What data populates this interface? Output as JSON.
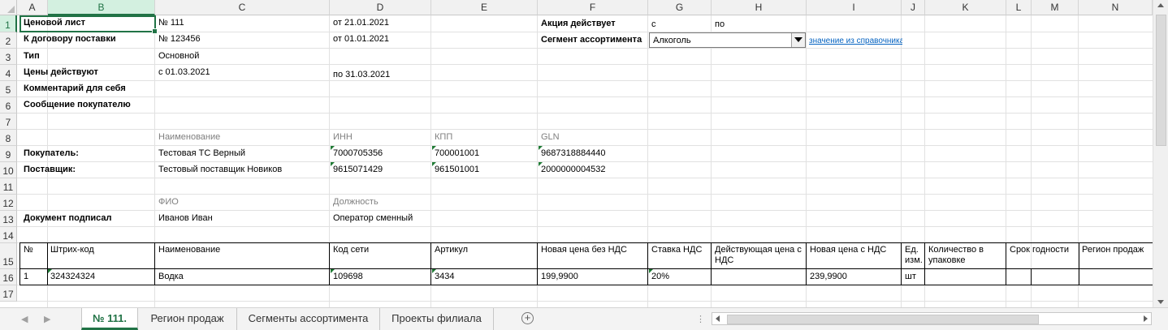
{
  "columns": [
    "A",
    "B",
    "C",
    "D",
    "E",
    "F",
    "G",
    "H",
    "I",
    "J",
    "K",
    "L",
    "M",
    "N"
  ],
  "rows": [
    "1",
    "2",
    "3",
    "4",
    "5",
    "6",
    "7",
    "8",
    "9",
    "10",
    "11",
    "12",
    "13",
    "14",
    "15",
    "16",
    "17"
  ],
  "header_block": {
    "price_list_label": "Ценовой лист",
    "price_list_no": "№ 111",
    "price_list_date": "от 21.01.2021",
    "contract_label": "К договору поставки",
    "contract_no": "№ 123456",
    "contract_date": "от 01.01.2021",
    "type_label": "Тип",
    "type_value": "Основной",
    "prices_valid_label": "Цены действуют",
    "prices_valid_from": "с 01.03.2021",
    "prices_valid_to": "по 31.03.2021",
    "comment_label": "Комментарий для себя",
    "message_label": "Сообщение покупателю",
    "promo_label": "Акция действует",
    "promo_from": "с",
    "promo_to": "по",
    "segment_label": "Сегмент ассортимента",
    "segment_value": "Алкоголь",
    "segment_link": "значение из справочника"
  },
  "parties": {
    "col_name": "Наименование",
    "col_inn": "ИНН",
    "col_kpp": "КПП",
    "col_gln": "GLN",
    "buyer_label": "Покупатель:",
    "buyer_name": "Тестовая ТС Верный",
    "buyer_inn": "7000705356",
    "buyer_kpp": "700001001",
    "buyer_gln": "9687318884440",
    "supplier_label": "Поставщик:",
    "supplier_name": "Тестовый поставщик Новиков",
    "supplier_inn": "9615071429",
    "supplier_kpp": "961501001",
    "supplier_gln": "2000000004532"
  },
  "signer": {
    "col_fio": "ФИО",
    "col_position": "Должность",
    "label": "Документ подписал",
    "fio": "Иванов Иван",
    "position": "Оператор сменный"
  },
  "table": {
    "headers": [
      "№",
      "Штрих-код",
      "Наименование",
      "Код сети",
      "Артикул",
      "Новая цена без НДС",
      "Ставка НДС",
      "Действующая цена с НДС",
      "Новая цена с НДС",
      "Ед. изм.",
      "Количество в упаковке",
      "Срок годности",
      "Регион продаж"
    ],
    "rows": [
      [
        "1",
        "324324324",
        "Водка",
        "109698",
        "3434",
        "199,9900",
        "20%",
        "",
        "239,9900",
        "шт",
        "",
        "",
        ""
      ]
    ]
  },
  "tabs": {
    "items": [
      "№ 111.",
      "Регион продаж",
      "Сегменты ассортимента",
      "Проекты филиала"
    ],
    "active_index": 0
  },
  "colors": {
    "accent": "#217346",
    "link": "#0563c1",
    "grid": "#e1e1e1"
  }
}
